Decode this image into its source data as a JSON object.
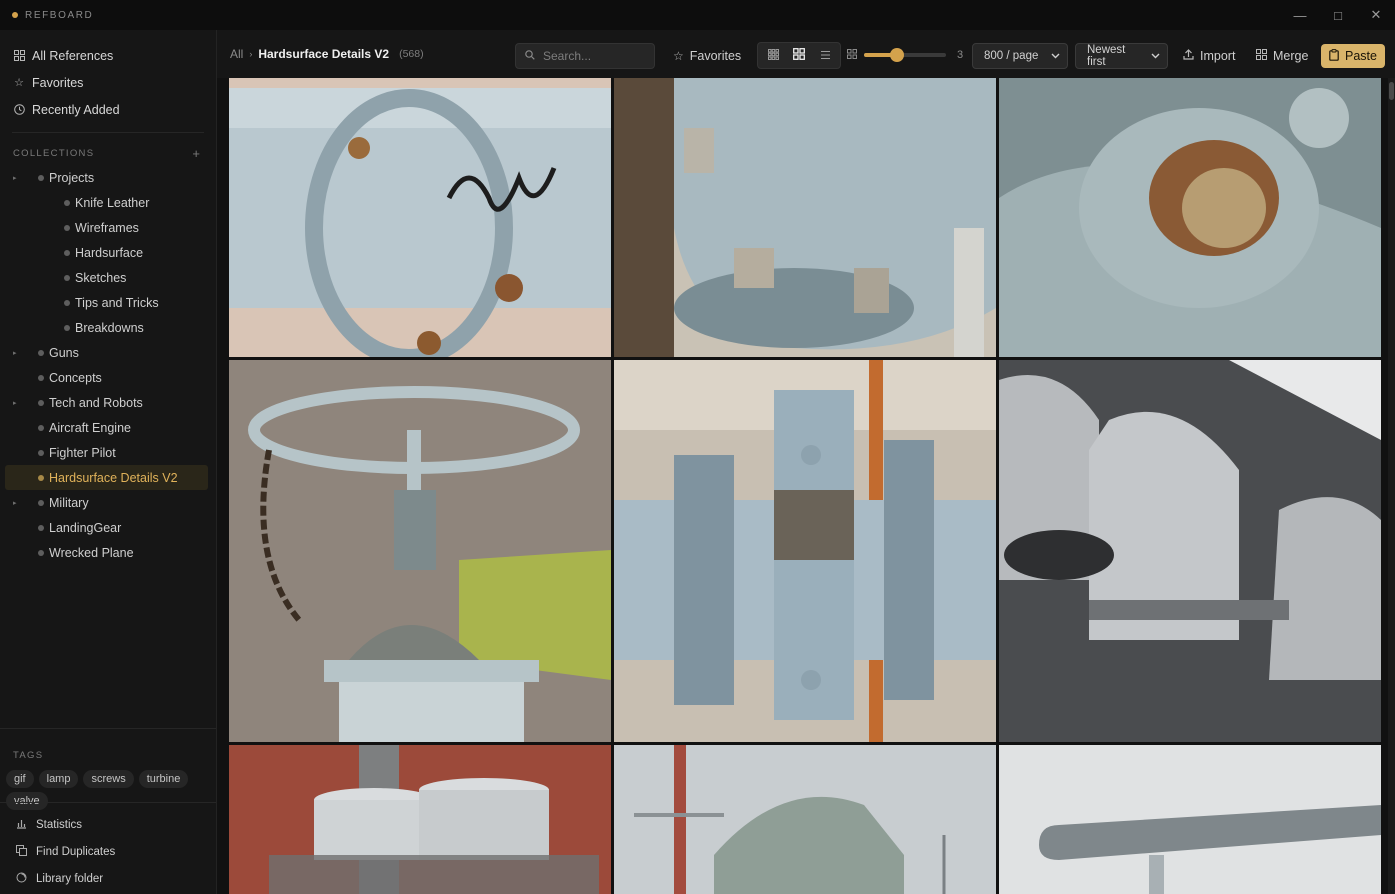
{
  "app": {
    "name": "REFBOARD",
    "accent": "#d4a24c"
  },
  "window": {
    "minimize": "—",
    "maximize": "□",
    "close": "✕"
  },
  "sidebar": {
    "nav": [
      {
        "label": "All References",
        "icon": "grid-icon"
      },
      {
        "label": "Favorites",
        "icon": "star-icon"
      },
      {
        "label": "Recently Added",
        "icon": "clock-icon"
      }
    ],
    "collections_title": "COLLECTIONS",
    "collections_add": "+",
    "collections": [
      {
        "label": "Projects",
        "level": 0,
        "expandable": true,
        "active": false
      },
      {
        "label": "Knife Leather",
        "level": 1,
        "expandable": false,
        "active": false
      },
      {
        "label": "Wireframes",
        "level": 1,
        "expandable": false,
        "active": false
      },
      {
        "label": "Hardsurface",
        "level": 1,
        "expandable": false,
        "active": false
      },
      {
        "label": "Sketches",
        "level": 1,
        "expandable": false,
        "active": false
      },
      {
        "label": "Tips and Tricks",
        "level": 1,
        "expandable": false,
        "active": false
      },
      {
        "label": "Breakdowns",
        "level": 1,
        "expandable": false,
        "active": false
      },
      {
        "label": "Guns",
        "level": 0,
        "expandable": true,
        "active": false
      },
      {
        "label": "Concepts",
        "level": 0,
        "expandable": false,
        "active": false
      },
      {
        "label": "Tech and Robots",
        "level": 0,
        "expandable": true,
        "active": false
      },
      {
        "label": "Aircraft Engine",
        "level": 0,
        "expandable": false,
        "active": false
      },
      {
        "label": "Fighter Pilot",
        "level": 0,
        "expandable": false,
        "active": false
      },
      {
        "label": "Hardsurface Details V2",
        "level": 0,
        "expandable": false,
        "active": true
      },
      {
        "label": "Military",
        "level": 0,
        "expandable": true,
        "active": false
      },
      {
        "label": "LandingGear",
        "level": 0,
        "expandable": false,
        "active": false
      },
      {
        "label": "Wrecked Plane",
        "level": 0,
        "expandable": false,
        "active": false
      }
    ],
    "tags_title": "TAGS",
    "tags": [
      "gif",
      "lamp",
      "screws",
      "turbine",
      "valve"
    ],
    "footer": [
      {
        "label": "Statistics",
        "icon": "chart-icon"
      },
      {
        "label": "Find Duplicates",
        "icon": "duplicate-icon"
      },
      {
        "label": "Library folder",
        "icon": "folder-icon"
      }
    ]
  },
  "toolbar": {
    "breadcrumb_root": "All",
    "breadcrumb_current": "Hardsurface Details V2",
    "count": "(568)",
    "search_placeholder": "Search...",
    "favorites": "Favorites",
    "view_modes": [
      "compact-grid",
      "grid",
      "list"
    ],
    "active_view": 1,
    "columns_value": 3,
    "columns_min": 1,
    "columns_max": 6,
    "per_page": "800 / page",
    "sort": "Newest first",
    "import": "Import",
    "merge": "Merge",
    "paste": "Paste"
  },
  "images": [
    {
      "subject": "pipe-flange-graffiti",
      "colors": [
        "#b9c8cf",
        "#8fa2ab",
        "#d9c5b6"
      ]
    },
    {
      "subject": "pipe-elbow-bolts",
      "colors": [
        "#a8b9c0",
        "#7a8d94",
        "#c9c2b5"
      ]
    },
    {
      "subject": "rusted-bolt-closeup",
      "colors": [
        "#9fb0b3",
        "#7e8f92",
        "#8a5a35"
      ]
    },
    {
      "subject": "valve-handwheel-chain",
      "colors": [
        "#b6c4c8",
        "#7d8a8c",
        "#a9b44d"
      ]
    },
    {
      "subject": "pipe-coupling-bolts",
      "colors": [
        "#a9bbc6",
        "#7f939f",
        "#c8bfb2"
      ]
    },
    {
      "subject": "rooftop-vent-hoods",
      "colors": [
        "#b7babd",
        "#6e7174",
        "#4a4c4f"
      ]
    },
    {
      "subject": "brick-wall-units",
      "colors": [
        "#9c4a3a",
        "#d9dcde",
        "#6f6f6f"
      ]
    },
    {
      "subject": "ship-tank-antenna",
      "colors": [
        "#8f9e96",
        "#c8cdd0",
        "#a34b3d"
      ]
    },
    {
      "subject": "rail-beam-sky",
      "colors": [
        "#e0e2e3",
        "#7f878b",
        "#a8b0b4"
      ]
    }
  ]
}
